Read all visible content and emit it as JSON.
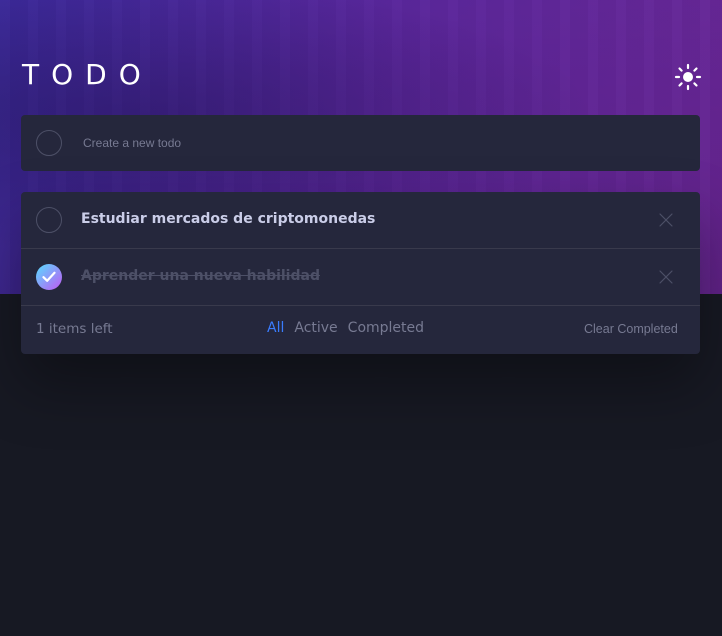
{
  "app": {
    "title": "TODO",
    "theme_toggle_icon": "sun-icon"
  },
  "new_todo": {
    "placeholder": "Create a new todo",
    "value": ""
  },
  "todos": [
    {
      "label": "Estudiar mercados de criptomonedas",
      "completed": false
    },
    {
      "label": "Aprender una nueva habilidad",
      "completed": true
    }
  ],
  "footer": {
    "items_left": "1 items left",
    "filters": {
      "all": "All",
      "active": "Active",
      "completed": "Completed",
      "selected": "All"
    },
    "clear_label": "Clear Completed"
  },
  "colors": {
    "accent": "#3a7cfd",
    "panel": "#25273c",
    "background": "#171923",
    "check_gradient_start": "#57ddff",
    "check_gradient_end": "#c058f3"
  }
}
